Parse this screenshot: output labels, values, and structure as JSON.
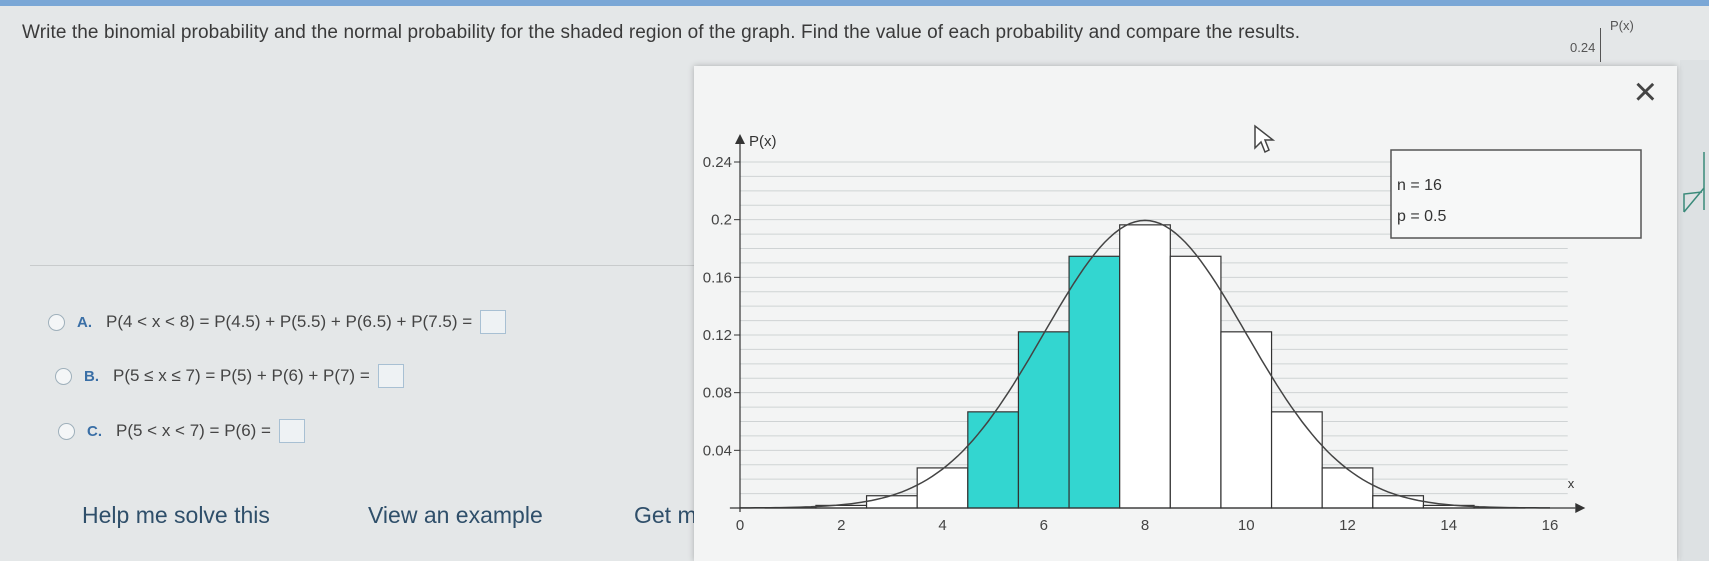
{
  "question": {
    "text": "Write the binomial probability and the normal probability for the shaded region of the graph. Find the value of each probability and compare the results.",
    "mini_axis_tick": "0.24",
    "mini_axis_label": "P(x)"
  },
  "options": [
    {
      "letter": "A.",
      "text": "P(4 < x < 8) = P(4.5) + P(5.5) + P(6.5) + P(7.5) ="
    },
    {
      "letter": "B.",
      "text": "P(5 ≤ x ≤ 7) = P(5) + P(6) + P(7) ="
    },
    {
      "letter": "C.",
      "text": "P(5 < x < 7) = P(6) ="
    }
  ],
  "footer": {
    "help": "Help me solve this",
    "example": "View an example",
    "get_more": "Get m"
  },
  "modal": {
    "close_symbol": "×",
    "param_n": "n = 16",
    "param_p": "p = 0.5"
  },
  "colors": {
    "shaded": "#33d6d0",
    "accent": "#3a6fa6"
  },
  "chart_data": {
    "type": "bar",
    "ylabel": "P(x)",
    "xlabel": "x",
    "x": [
      0,
      1,
      2,
      3,
      4,
      5,
      6,
      7,
      8,
      9,
      10,
      11,
      12,
      13,
      14,
      15,
      16
    ],
    "values": [
      0.0,
      0.0002,
      0.0018,
      0.0085,
      0.0278,
      0.0667,
      0.1222,
      0.1746,
      0.1964,
      0.1746,
      0.1222,
      0.0667,
      0.0278,
      0.0085,
      0.0018,
      0.0002,
      0.0
    ],
    "shaded": [
      5,
      6,
      7
    ],
    "yticks": [
      "0.24",
      "0.2",
      "0.16",
      "0.12",
      "0.08",
      "0.04"
    ],
    "ytick_values": [
      0.24,
      0.2,
      0.16,
      0.12,
      0.08,
      0.04
    ],
    "xticks": [
      "0",
      "2",
      "4",
      "6",
      "8",
      "10",
      "12",
      "14",
      "16"
    ],
    "xtick_values": [
      0,
      2,
      4,
      6,
      8,
      10,
      12,
      14,
      16
    ],
    "ylim": [
      0,
      0.24
    ],
    "xlim": [
      0,
      16
    ],
    "curve": {
      "mean": 8,
      "sd": 2
    },
    "grid": true,
    "legend": "top-right"
  }
}
